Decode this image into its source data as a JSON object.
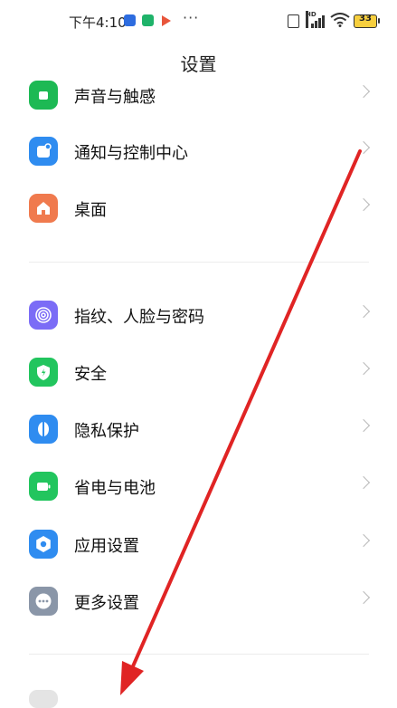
{
  "status_bar": {
    "time": "下午4:10",
    "more": "···",
    "hd": "HD",
    "battery": "33"
  },
  "header": {
    "title": "设置"
  },
  "group1": [
    {
      "label": "声音与触感",
      "icon": "sound-icon",
      "color": "#1db954"
    },
    {
      "label": "通知与控制中心",
      "icon": "notification-icon",
      "color": "#2f8cf0"
    },
    {
      "label": "桌面",
      "icon": "home-icon",
      "color": "#f07a4e"
    }
  ],
  "group2": [
    {
      "label": "指纹、人脸与密码",
      "icon": "fingerprint-icon",
      "color": "#7b6cf6"
    },
    {
      "label": "安全",
      "icon": "shield-icon",
      "color": "#22c55e"
    },
    {
      "label": "隐私保护",
      "icon": "privacy-icon",
      "color": "#2f8cf0"
    },
    {
      "label": "省电与电池",
      "icon": "battery-icon",
      "color": "#22c55e"
    },
    {
      "label": "应用设置",
      "icon": "gear-icon",
      "color": "#2f8cf0"
    },
    {
      "label": "更多设置",
      "icon": "more-icon",
      "color": "#8a96a8"
    }
  ],
  "annotation": {
    "color": "#e02424"
  }
}
